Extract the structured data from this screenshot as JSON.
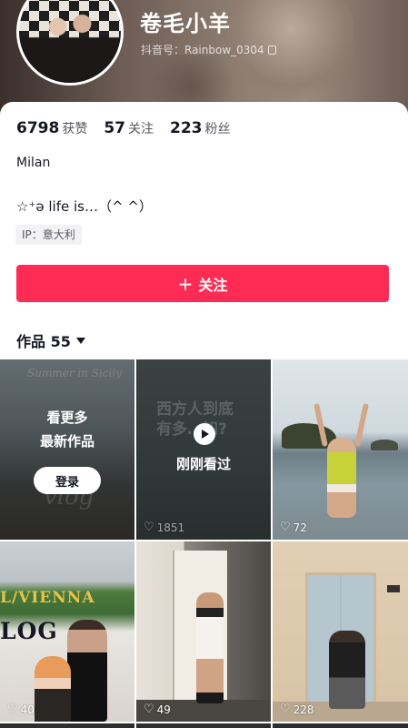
{
  "profile": {
    "username": "卷毛小羊",
    "handle": "抖音号：Rainbow_0304",
    "location": "Milan",
    "bio": "☆⁺ə life is…（^ ^）",
    "ip": "IP：意大利"
  },
  "stats": [
    {
      "value": "6798",
      "label": "获赞"
    },
    {
      "value": "57",
      "label": "关注"
    },
    {
      "value": "223",
      "label": "粉丝"
    }
  ],
  "follow_button": {
    "icon": "plus-icon",
    "label": "关注"
  },
  "works_tab": {
    "label": "作品 55"
  },
  "colors": {
    "accent": "#fe2c55",
    "text": "#161823",
    "muted": "#57585f"
  },
  "grid": {
    "tile1": {
      "title_line1": "看更多",
      "title_line2": "最新作品",
      "login_label": "登录",
      "script_text": "Summer in Sicily",
      "watermark": "vlog"
    },
    "tile2": {
      "bg_line1": "西方人到底",
      "bg_line2": "有多…知?",
      "watched_label": "刚刚看过",
      "likes": "1851"
    },
    "tile3": {
      "likes": "72"
    },
    "tile4": {
      "sign1": "L/VIENNA",
      "sign2": "LOG",
      "likes": "40"
    },
    "tile5": {
      "likes": "49"
    },
    "tile6": {
      "likes": "228"
    }
  }
}
